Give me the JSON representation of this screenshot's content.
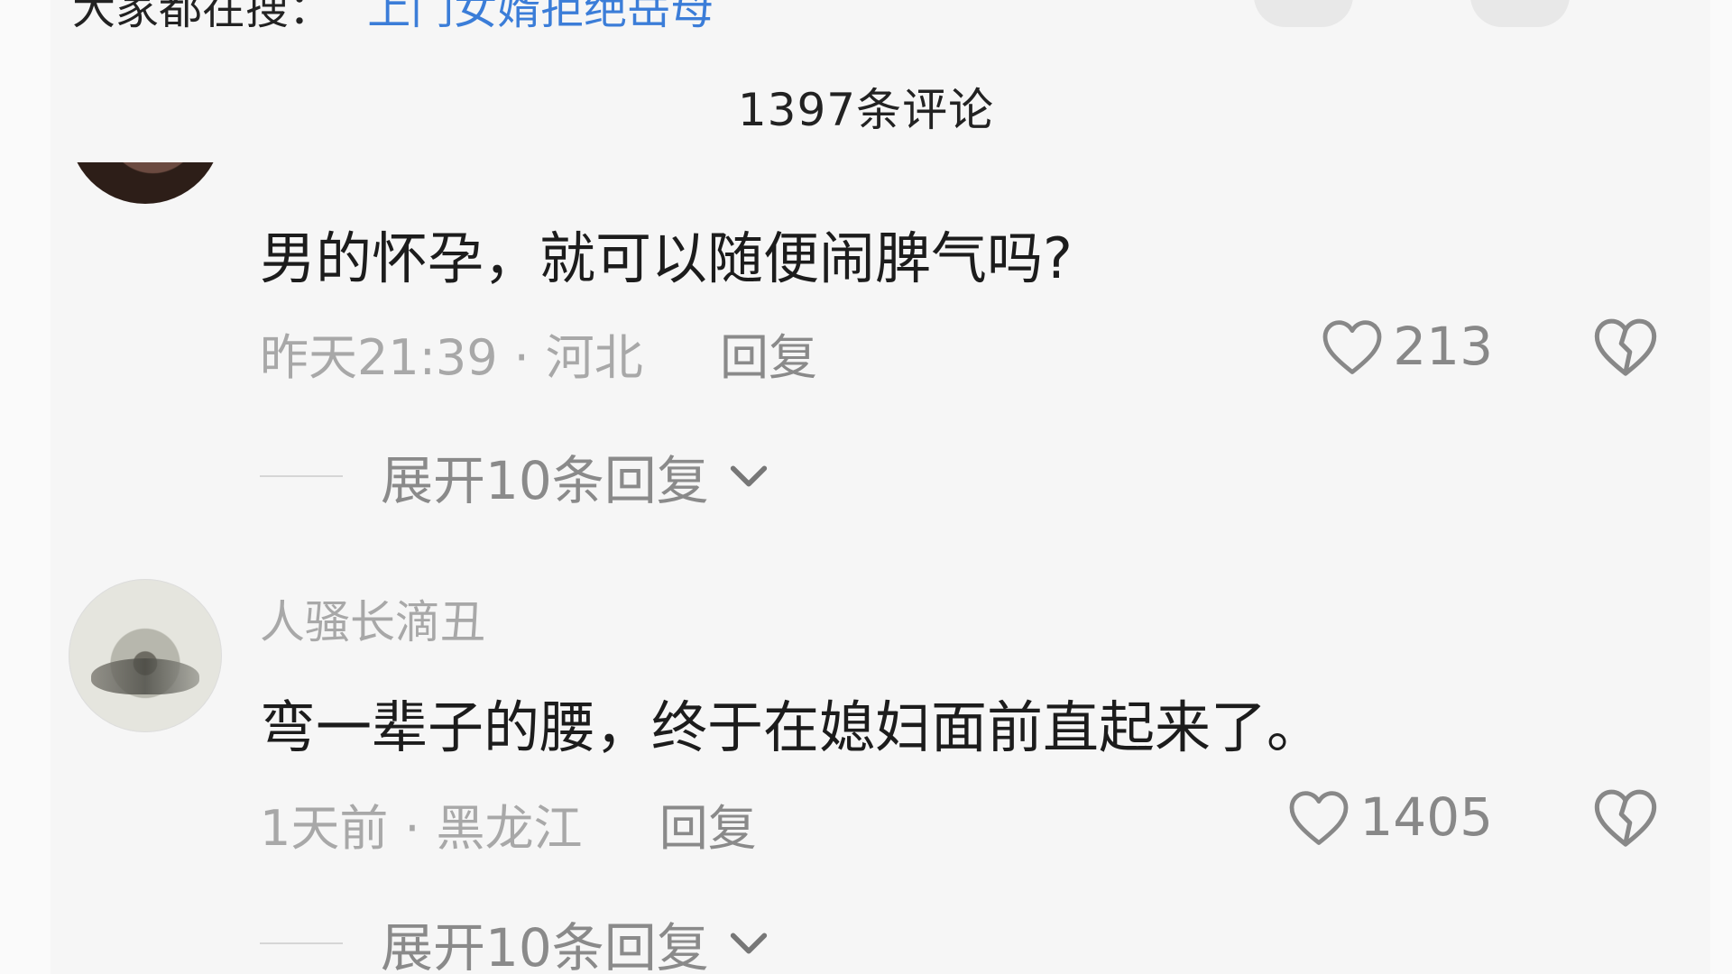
{
  "header": {
    "partial_text": "大家都在搜：",
    "partial_link": "上门女婿拒绝岳母"
  },
  "comment_count": "1397条评论",
  "comments": [
    {
      "username": "",
      "text": "男的怀孕，就可以随便闹脾气吗?",
      "time": "昨天21:39",
      "location": "河北",
      "reply_label": "回复",
      "likes": "213",
      "expand_label": "展开10条回复"
    },
    {
      "username": "人骚长滴丑",
      "text": "弯一辈子的腰，终于在媳妇面前直起来了。",
      "time": "1天前",
      "location": "黑龙江",
      "reply_label": "回复",
      "likes": "1405",
      "expand_label": "展开10条回复"
    }
  ],
  "colors": {
    "text_primary": "#1c1c1c",
    "text_secondary": "#a8a8a8",
    "link": "#3b7dd8",
    "background": "#f6f6f6"
  },
  "icons": [
    "heart-icon",
    "dislike-icon",
    "chevron-down-icon"
  ]
}
